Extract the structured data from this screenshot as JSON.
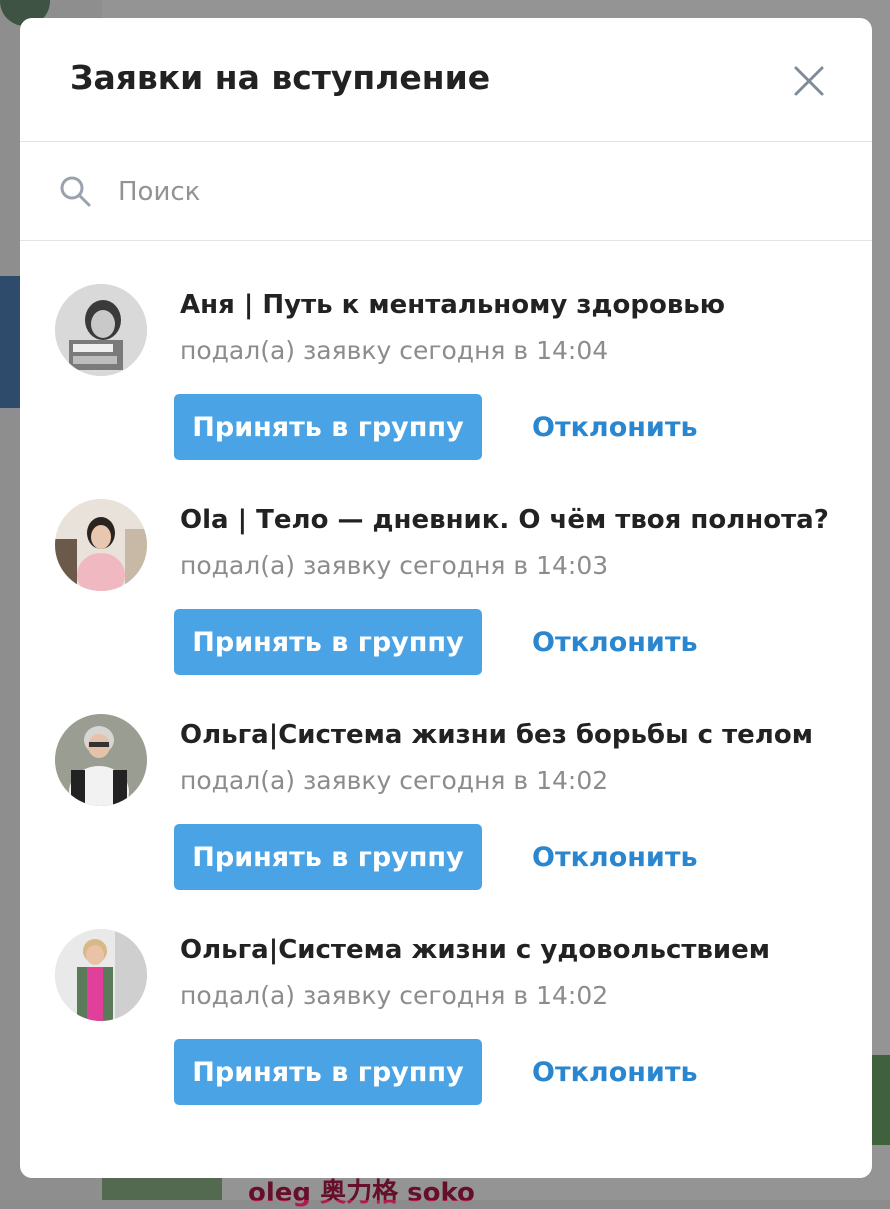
{
  "modal": {
    "title": "Заявки на вступление"
  },
  "search": {
    "placeholder": "Поиск"
  },
  "requests": [
    {
      "name": "Аня | Путь к ментальному здоровью",
      "time": "подал(а) заявку сегодня в 14:04",
      "accept_label": "Принять в группу",
      "decline_label": "Отклонить"
    },
    {
      "name": "Ola | Тело — дневник. О чём твоя полнота?",
      "time": "подал(а) заявку сегодня в 14:03",
      "accept_label": "Принять в группу",
      "decline_label": "Отклонить"
    },
    {
      "name": "Ольга|Система жизни без борьбы с телом",
      "time": "подал(а) заявку сегодня в 14:02",
      "accept_label": "Принять в группу",
      "decline_label": "Отклонить"
    },
    {
      "name": "Ольга|Система жизни с удовольствием",
      "time": "подал(а) заявку сегодня в 14:02",
      "accept_label": "Принять в группу",
      "decline_label": "Отклонить"
    }
  ],
  "background": {
    "bottom_name": "oleg 奥力格 soko"
  },
  "colors": {
    "accept": "#4aa3e4",
    "decline": "#2a86cf",
    "muted": "#8c8c8c"
  }
}
